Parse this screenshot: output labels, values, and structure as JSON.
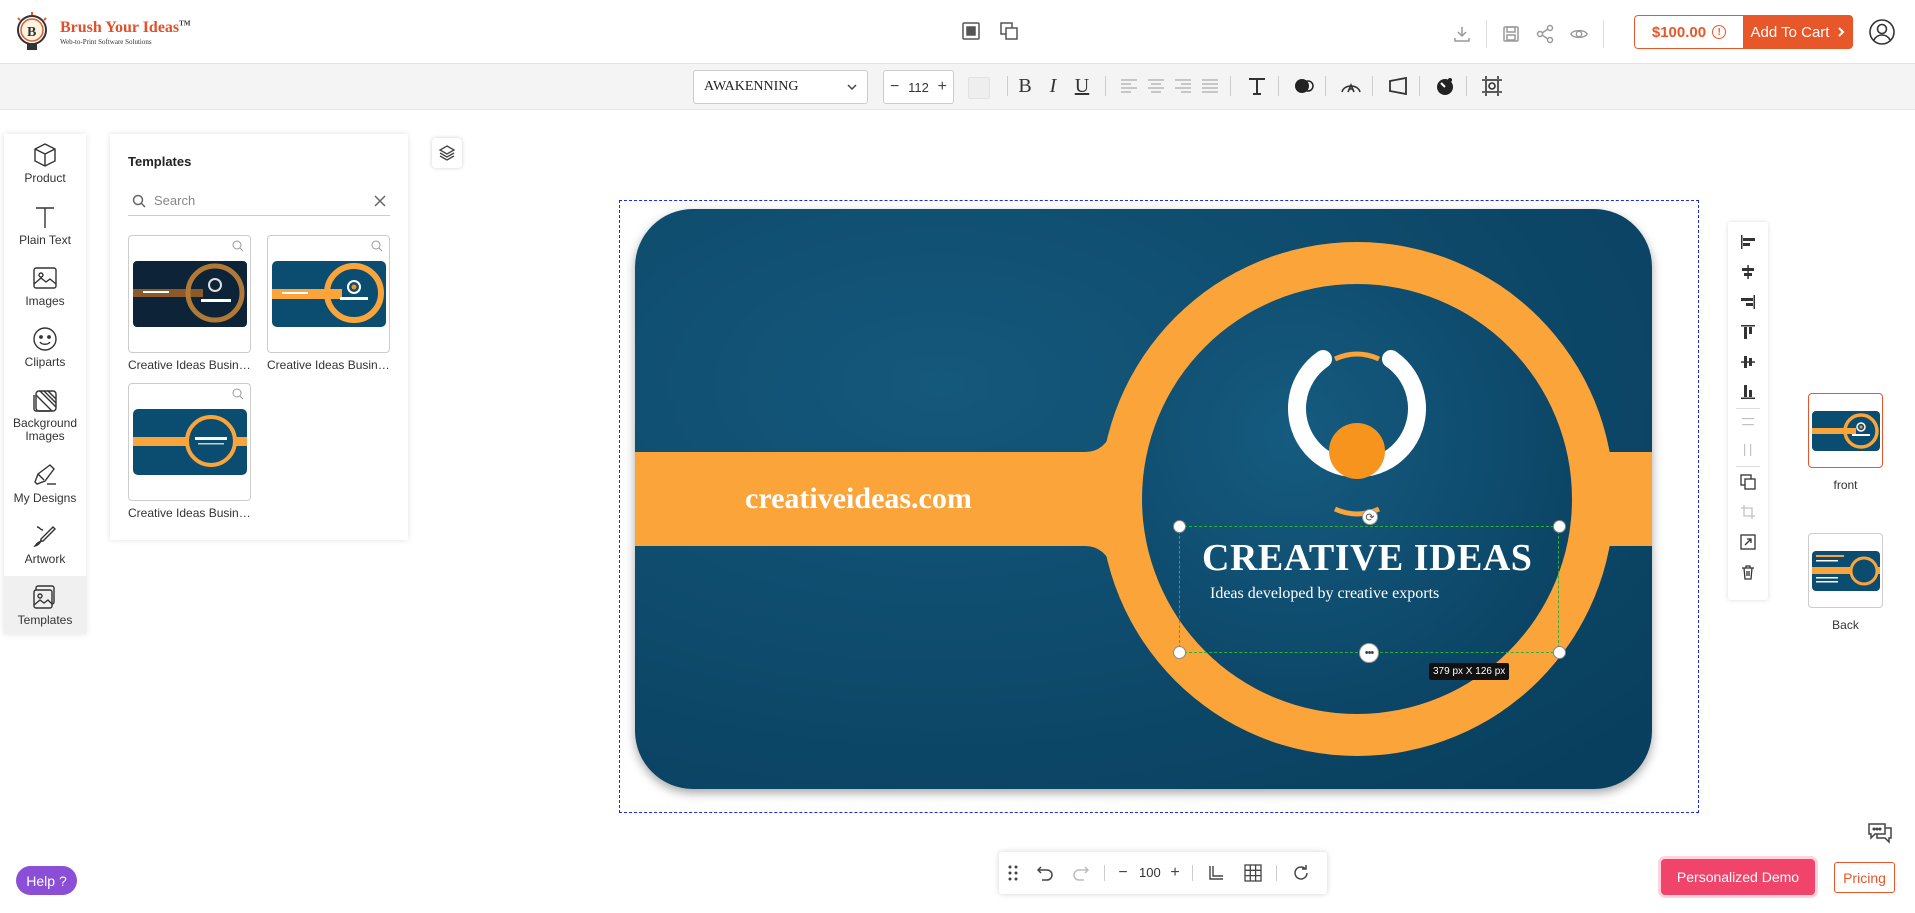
{
  "brand": {
    "name": "Brush Your Ideas",
    "trademark": "TM",
    "tagline": "Web-to-Print Software Solutions"
  },
  "header": {
    "price": "$100.00",
    "price_info_glyph": "!",
    "add_to_cart": "Add To Cart",
    "icons": [
      "layer-forward-icon",
      "layer-backward-icon",
      "download-icon",
      "save-icon",
      "share-icon",
      "preview-icon",
      "account-icon"
    ]
  },
  "toolbar": {
    "font_family": "AWAKENNING",
    "font_size": "112",
    "decrement": "−",
    "increment": "+",
    "bold": "B",
    "italic": "I",
    "underline": "U"
  },
  "sidebar": {
    "items": [
      {
        "label": "Product",
        "icon": "cube-icon"
      },
      {
        "label": "Plain Text",
        "icon": "text-icon"
      },
      {
        "label": "Images",
        "icon": "image-icon"
      },
      {
        "label": "Cliparts",
        "icon": "smiley-icon"
      },
      {
        "label": "Background Images",
        "icon": "background-icon"
      },
      {
        "label": "My Designs",
        "icon": "designs-icon"
      },
      {
        "label": "Artwork",
        "icon": "artwork-icon"
      },
      {
        "label": "Templates",
        "icon": "templates-icon"
      }
    ],
    "active": "Templates"
  },
  "templates_panel": {
    "title": "Templates",
    "search_placeholder": "Search",
    "search_value": "",
    "items": [
      {
        "caption": "Creative Ideas Business Card"
      },
      {
        "caption": "Creative Ideas Business Card"
      },
      {
        "caption": "Creative Ideas Business Card"
      }
    ]
  },
  "canvas": {
    "website": "creativeideas.com",
    "title": "CREATIVE IDEAS",
    "subtitle": "Ideas developed by creative exports",
    "selection_size": "379 px X 126 px",
    "colors": {
      "card_bg": "#0b4d70",
      "accent": "#fba43a",
      "logo_dot": "#f7941d"
    }
  },
  "pages": [
    {
      "label": "front",
      "active": true
    },
    {
      "label": "Back",
      "active": false
    }
  ],
  "bottom_toolbar": {
    "zoom": "100",
    "zoom_minus": "−",
    "zoom_plus": "+"
  },
  "help_label": "Help ?",
  "demo_label": "Personalized Demo",
  "pricing_label": "Pricing",
  "colors": {
    "accent": "#e8572a",
    "help": "#8a4fd6",
    "demo": "#f0446a"
  }
}
